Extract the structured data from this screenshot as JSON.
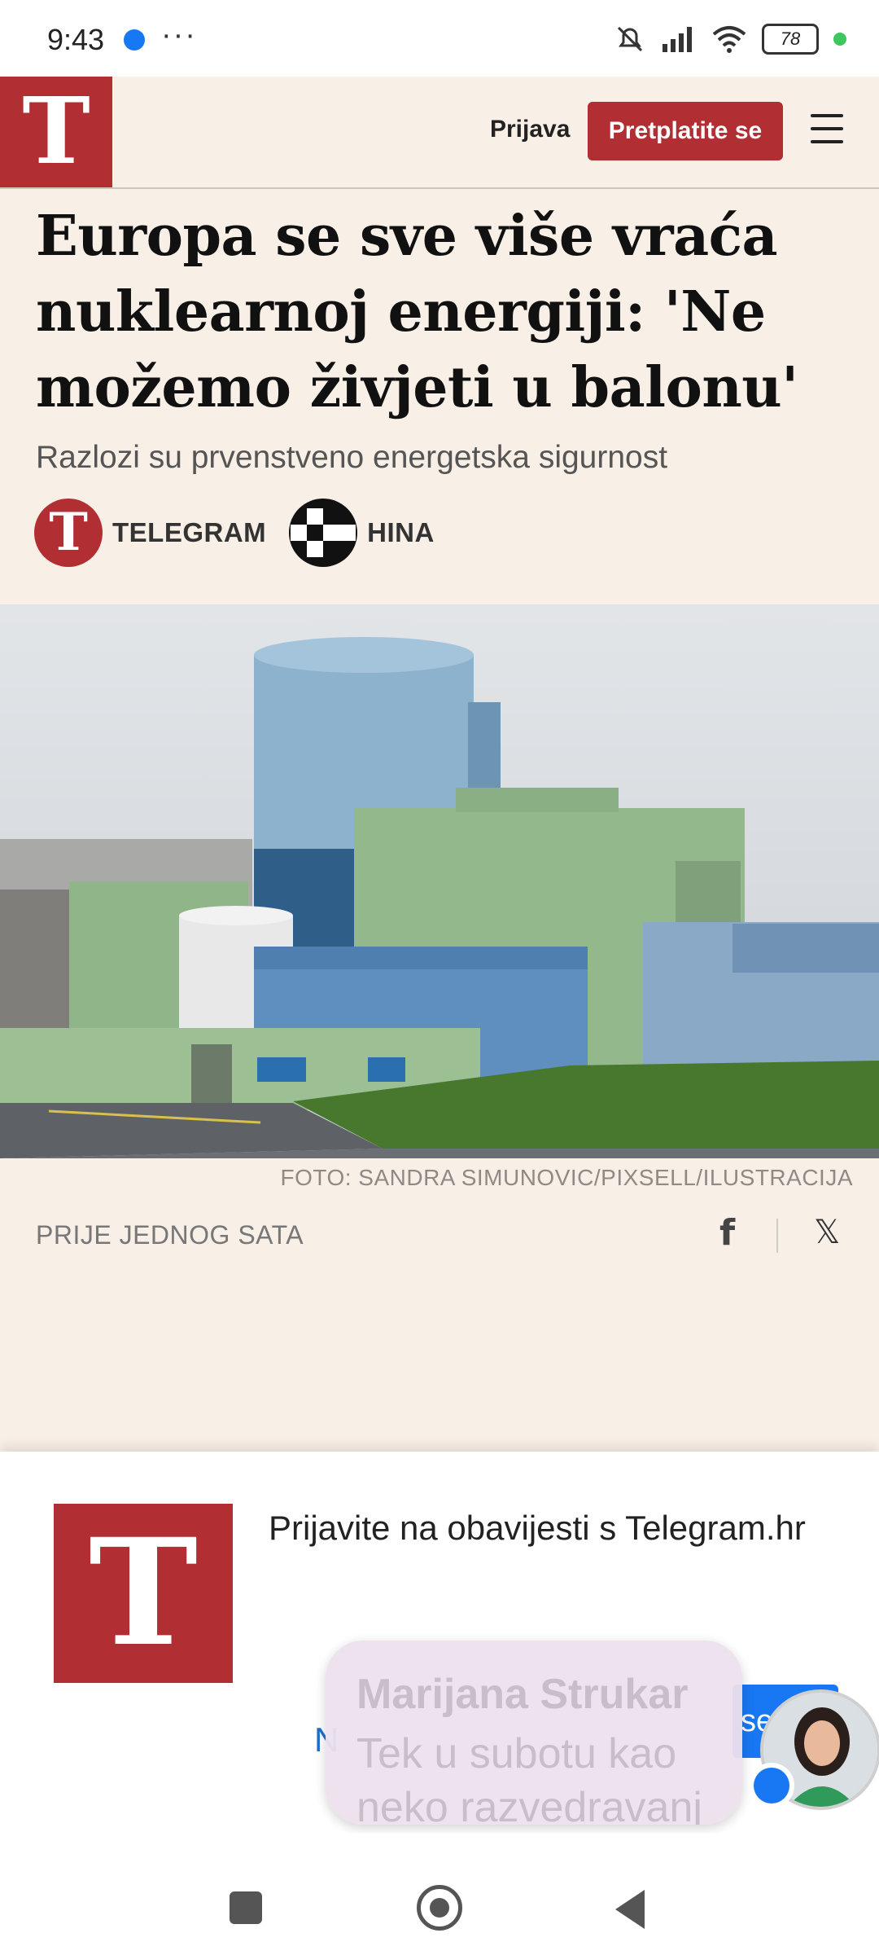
{
  "status_bar": {
    "time": "9:43",
    "dots": "···",
    "battery": "78",
    "icons": [
      "messenger-icon",
      "mute-icon",
      "signal-icon",
      "wifi-icon",
      "battery-icon"
    ]
  },
  "header": {
    "logo_letter": "T",
    "login_label": "Prijava",
    "subscribe_label": "Pretplatite se",
    "brand_color": "#b12f33",
    "background": "#f8efe6"
  },
  "article": {
    "headline": "Europa se sve više vraća nuklearnoj energiji: 'Ne možemo živjeti u balonu'",
    "subheadline": "Razlozi su prvenstveno energetska sigurnost",
    "authors": [
      {
        "name": "TELEGRAM",
        "avatar_letter": "T"
      },
      {
        "name": "HINA"
      }
    ],
    "photo_caption": "FOTO: SANDRA SIMUNOVIC/PIXSELL/ILUSTRACIJA",
    "published": "PRIJE JEDNOG SATA",
    "share": {
      "facebook": "f",
      "x": "𝕏"
    }
  },
  "notification_sheet": {
    "logo_letter": "T",
    "text": "Prijavite na obavijesti s Telegram.hr",
    "left_fragment": "N",
    "button_fragment": "se"
  },
  "chat_bubble": {
    "sender": "Marijana Strukar",
    "message": "Tek u subotu kao neko razvedravanj"
  }
}
